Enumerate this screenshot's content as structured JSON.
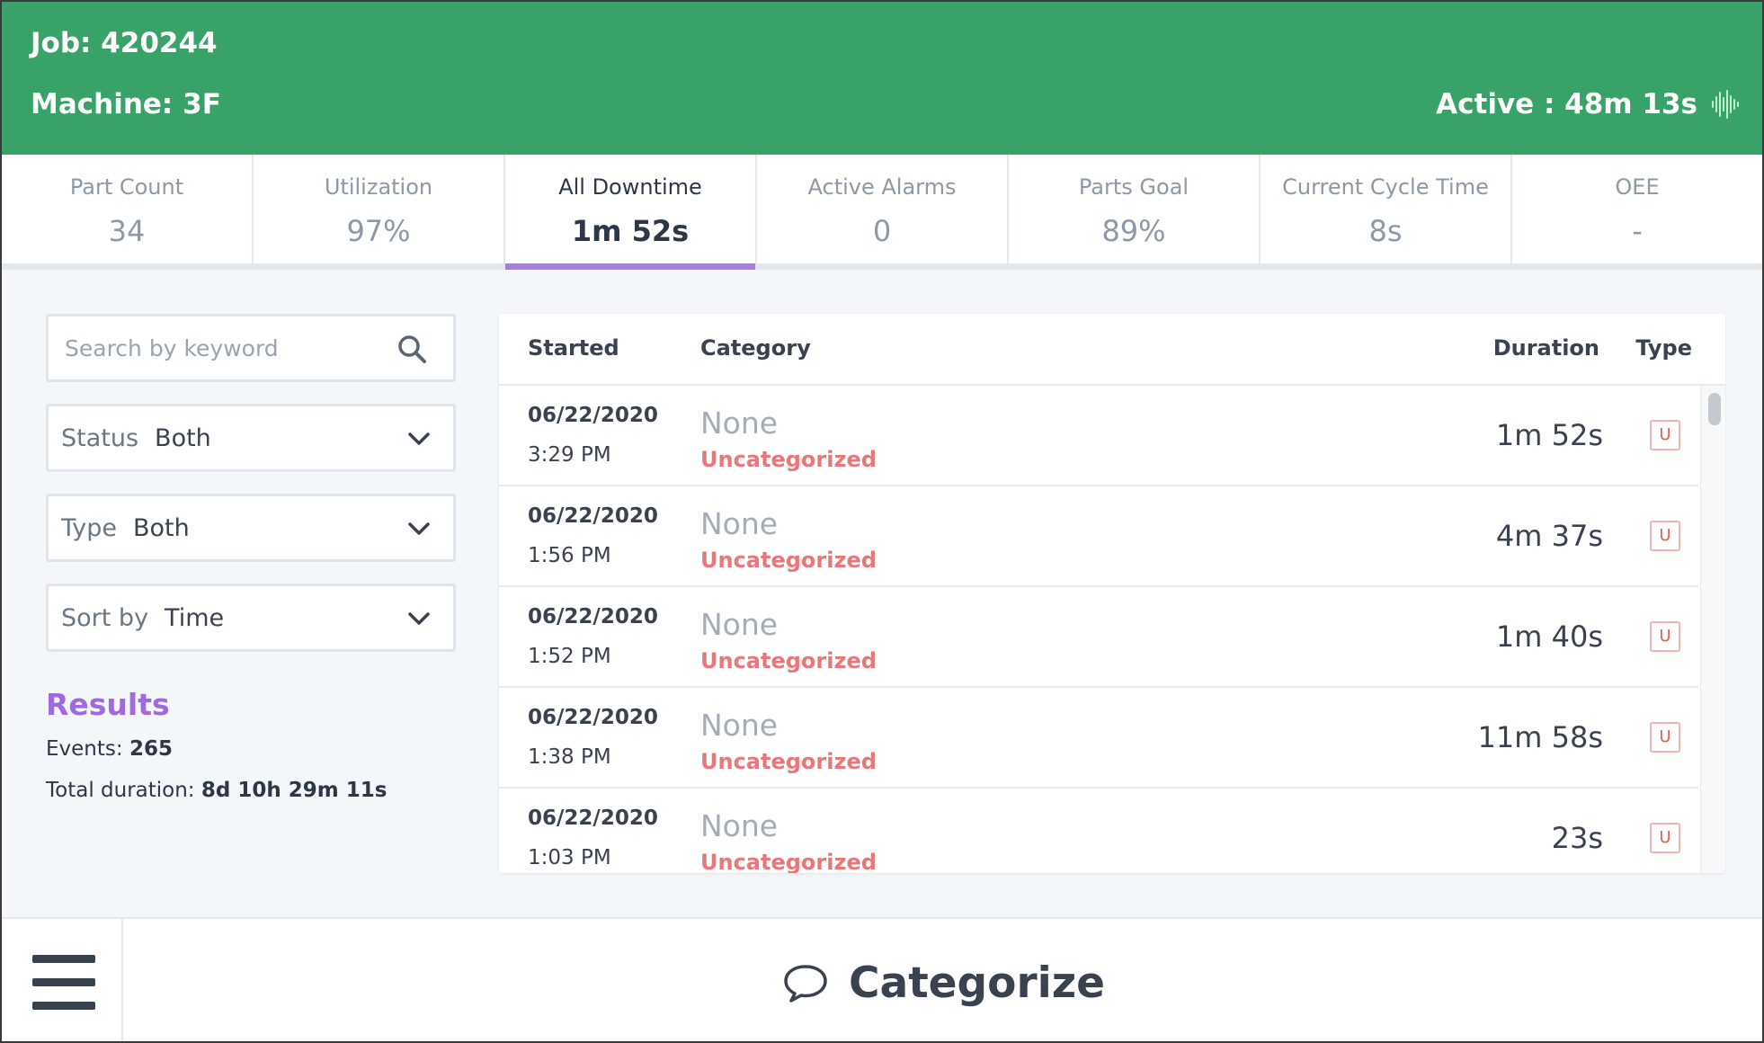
{
  "header": {
    "job": "Job: 420244",
    "machine": "Machine: 3F",
    "active": "Active : 48m 13s",
    "active_icon": "waveform-icon",
    "background_color": "#38a269"
  },
  "stats": [
    {
      "label": "Part Count",
      "value": "34"
    },
    {
      "label": "Utilization",
      "value": "97%"
    },
    {
      "label": "All Downtime",
      "value": "1m 52s",
      "selected": true
    },
    {
      "label": "Active Alarms",
      "value": "0"
    },
    {
      "label": "Parts Goal",
      "value": "89%"
    },
    {
      "label": "Current Cycle Time",
      "value": "8s"
    },
    {
      "label": "OEE",
      "value": "-"
    }
  ],
  "accent_color": "#a97ce6",
  "filters": {
    "search_placeholder": "Search by keyword",
    "status": {
      "label": "Status",
      "value": "Both"
    },
    "type": {
      "label": "Type",
      "value": "Both"
    },
    "sort": {
      "label": "Sort by",
      "value": "Time"
    }
  },
  "results": {
    "title": "Results",
    "events_label": "Events:",
    "events_value": "265",
    "total_label": "Total duration:",
    "total_value": "8d 10h 29m 11s"
  },
  "table": {
    "columns": {
      "started": "Started",
      "category": "Category",
      "duration": "Duration",
      "type": "Type"
    },
    "rows": [
      {
        "date": "06/22/2020",
        "time": "3:29 PM",
        "category": "None",
        "subcategory": "Uncategorized",
        "duration": "1m 52s",
        "type": "U"
      },
      {
        "date": "06/22/2020",
        "time": "1:56 PM",
        "category": "None",
        "subcategory": "Uncategorized",
        "duration": "4m 37s",
        "type": "U"
      },
      {
        "date": "06/22/2020",
        "time": "1:52 PM",
        "category": "None",
        "subcategory": "Uncategorized",
        "duration": "1m 40s",
        "type": "U"
      },
      {
        "date": "06/22/2020",
        "time": "1:38 PM",
        "category": "None",
        "subcategory": "Uncategorized",
        "duration": "11m 58s",
        "type": "U"
      },
      {
        "date": "06/22/2020",
        "time": "1:03 PM",
        "category": "None",
        "subcategory": "Uncategorized",
        "duration": "23s",
        "type": "U"
      }
    ]
  },
  "footer": {
    "menu_icon": "hamburger-menu-icon",
    "categorize_icon": "speech-bubble-icon",
    "categorize_label": "Categorize"
  }
}
